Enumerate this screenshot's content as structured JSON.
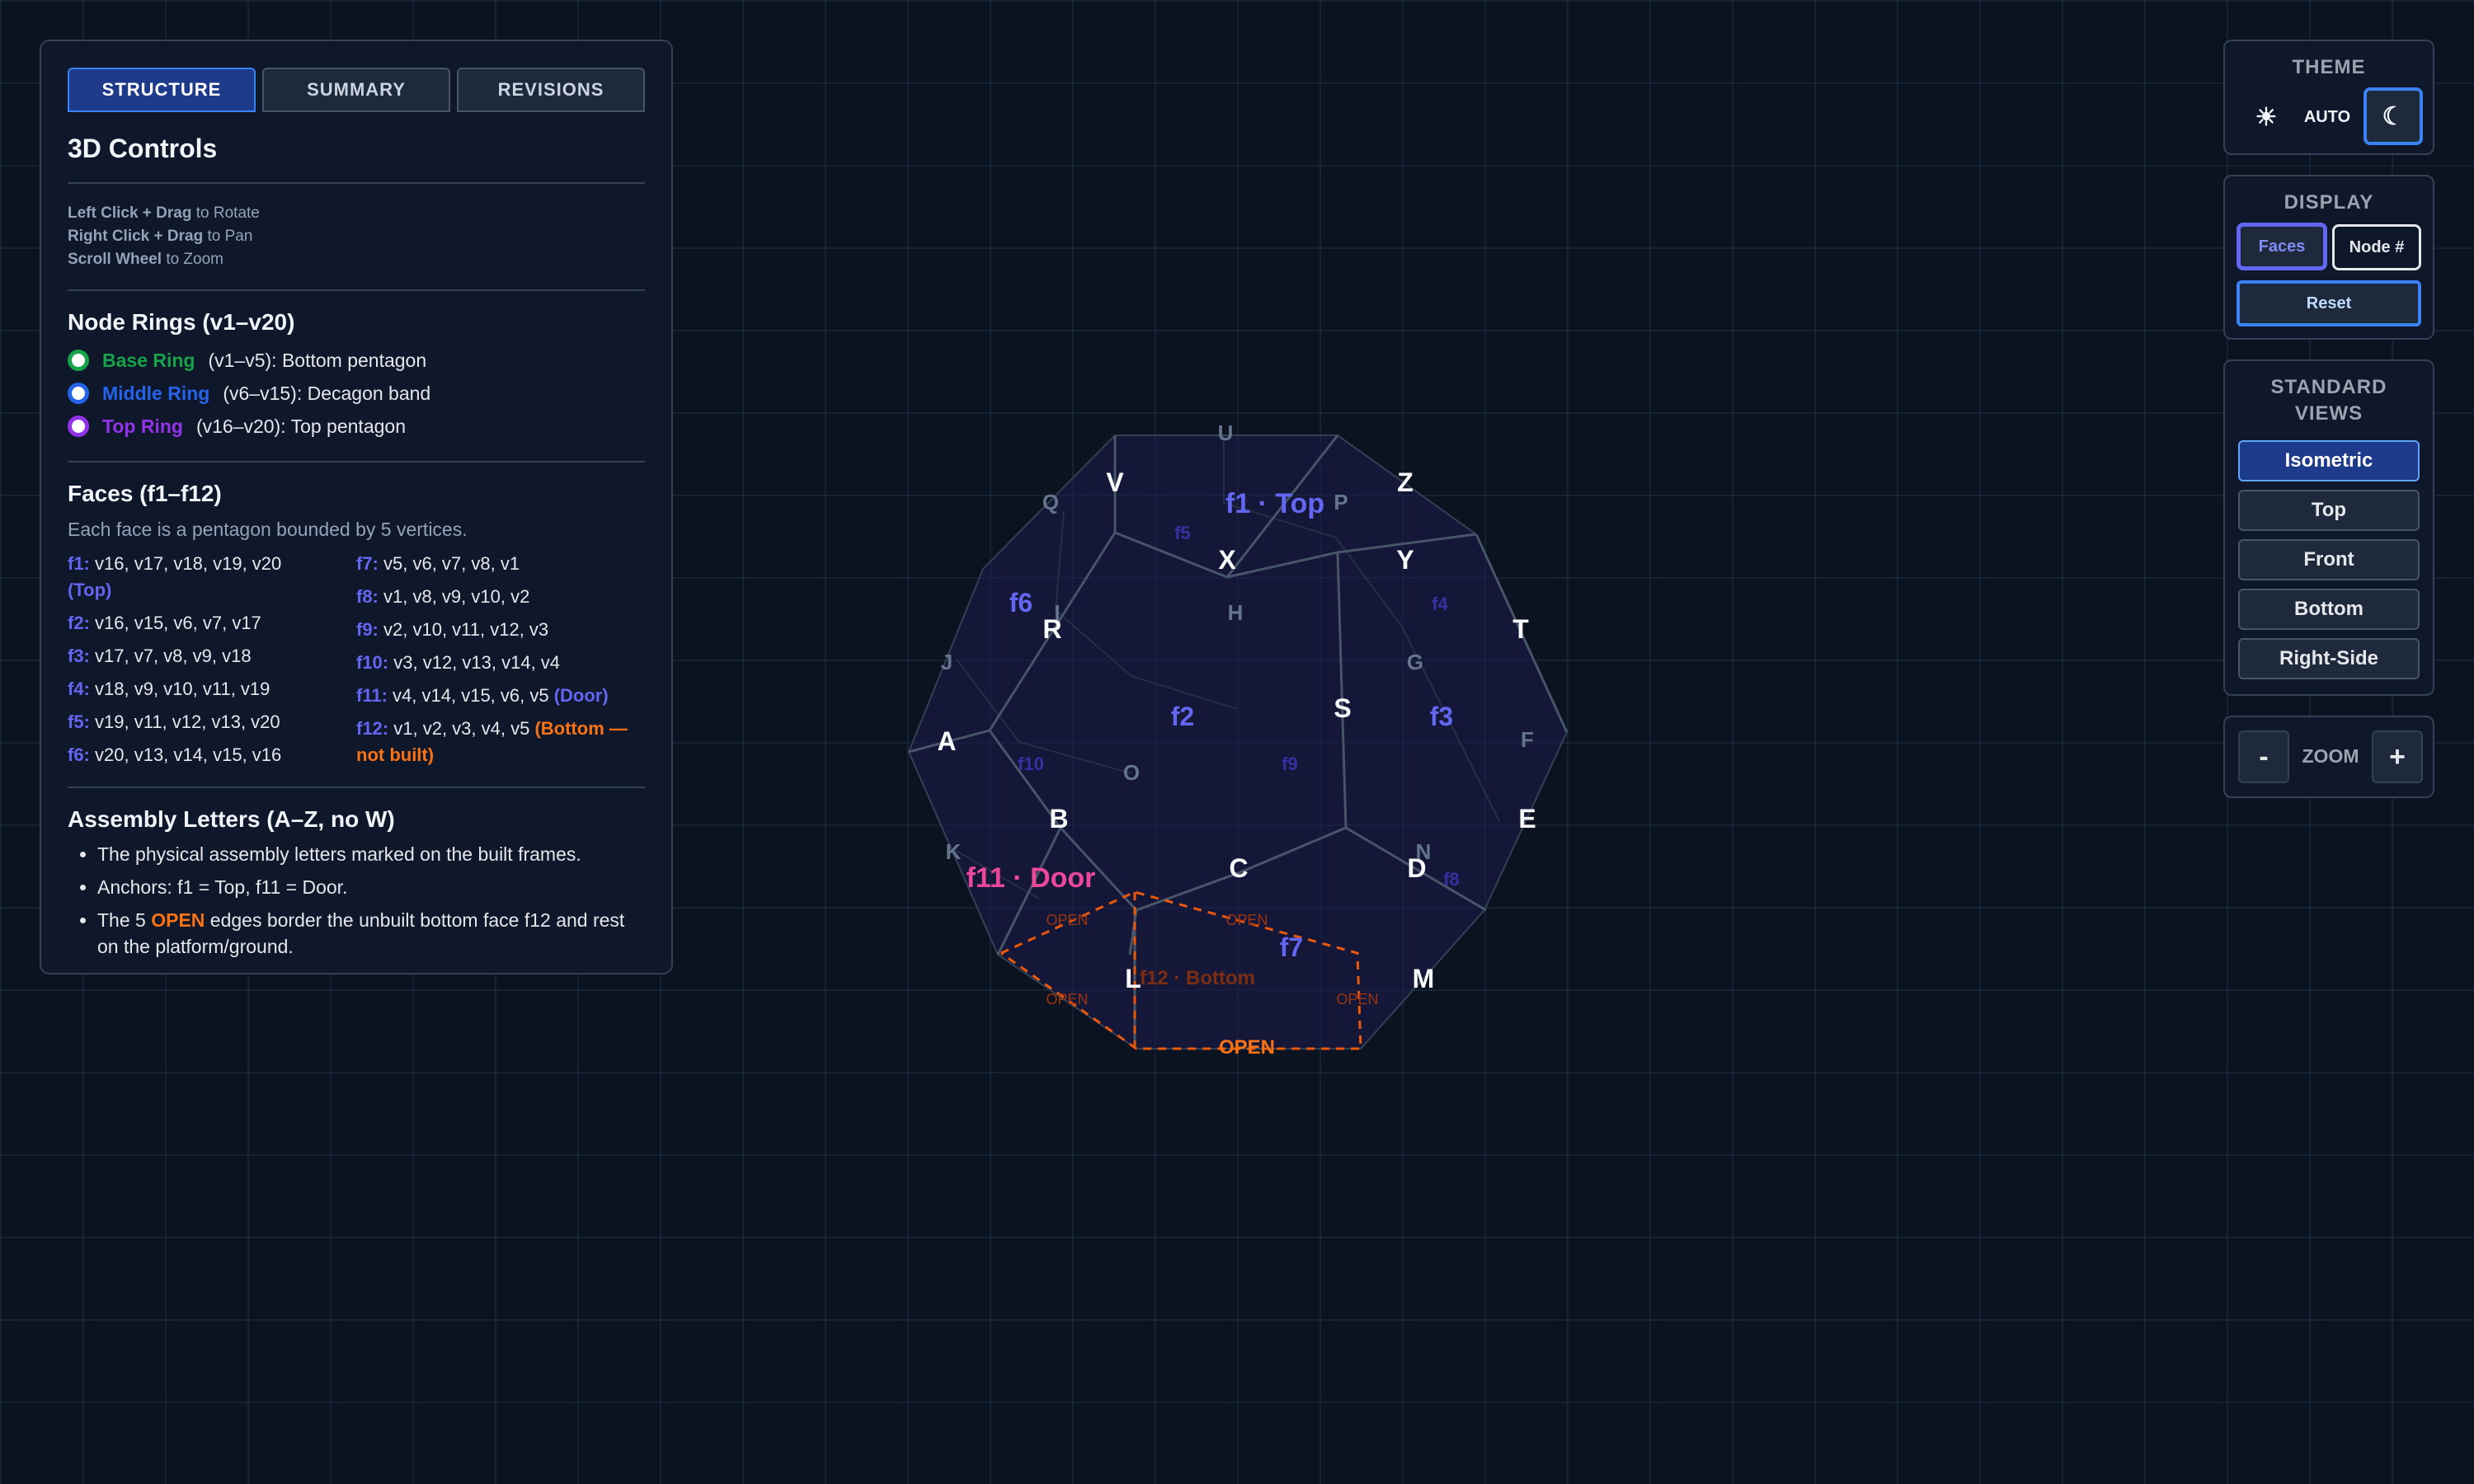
{
  "tabs": [
    {
      "label": "STRUCTURE"
    },
    {
      "label": "SUMMARY"
    },
    {
      "label": "REVISIONS"
    }
  ],
  "controls": {
    "title": "3D Controls",
    "items": [
      {
        "key": "Left Click + Drag",
        "text": "to Rotate"
      },
      {
        "key": "Right Click + Drag",
        "text": "to Pan"
      },
      {
        "key": "Scroll Wheel",
        "text": "to Zoom"
      }
    ]
  },
  "rings": {
    "title": "Node Rings (v1–v20)",
    "items": [
      {
        "name": "Base Ring",
        "range": "(v1–v5): Bottom pentagon",
        "color": "#16a34a"
      },
      {
        "name": "Middle Ring",
        "range": "(v6–v15): Decagon band",
        "color": "#2563eb"
      },
      {
        "name": "Top Ring",
        "range": "(v16–v20): Top pentagon",
        "color": "#9333ea"
      }
    ]
  },
  "faces": {
    "title": "Faces (f1–f12)",
    "description": "Each face is a pentagon bounded by 5 vertices.",
    "col1": [
      {
        "id": "f1:",
        "verts": "v16, v17, v18, v19, v20",
        "note": "(Top)"
      },
      {
        "id": "f2:",
        "verts": "v16, v15, v6, v7, v17",
        "note": ""
      },
      {
        "id": "f3:",
        "verts": "v17, v7, v8, v9, v18",
        "note": ""
      },
      {
        "id": "f4:",
        "verts": "v18, v9, v10, v11, v19",
        "note": ""
      },
      {
        "id": "f5:",
        "verts": "v19, v11, v12, v13, v20",
        "note": ""
      },
      {
        "id": "f6:",
        "verts": "v20, v13, v14, v15, v16",
        "note": ""
      }
    ],
    "col2": [
      {
        "id": "f7:",
        "verts": "v5, v6, v7, v8, v1",
        "note": ""
      },
      {
        "id": "f8:",
        "verts": "v1, v8, v9, v10, v2",
        "note": ""
      },
      {
        "id": "f9:",
        "verts": "v2, v10, v11, v12, v3",
        "note": ""
      },
      {
        "id": "f10:",
        "verts": "v3, v12, v13, v14, v4",
        "note": ""
      },
      {
        "id": "f11:",
        "verts": "v4, v14, v15, v6, v5",
        "note": "(Door)"
      },
      {
        "id": "f12:",
        "verts": "v1, v2, v3, v4, v5",
        "note": "(Bottom — not built)"
      }
    ]
  },
  "assembly": {
    "title": "Assembly Letters (A–Z, no W)",
    "item1": "The physical assembly letters marked on the built frames.",
    "item2": "Anchors: f1 = Top, f11 = Door.",
    "item3_pre": "The 5",
    "item3_open": "OPEN",
    "item3_post": "edges border the unbuilt bottom face f12 and rest on the platform/ground."
  },
  "theme": {
    "title": "THEME",
    "light_icon": "☀",
    "auto_label": "AUTO",
    "dark_icon": "☾",
    "active": "dark"
  },
  "display": {
    "title": "DISPLAY",
    "faces_label": "Faces",
    "node_label": "Node #",
    "reset_label": "Reset"
  },
  "views": {
    "title_line1": "STANDARD",
    "title_line2": "VIEWS",
    "items": [
      {
        "label": "Isometric",
        "active": true
      },
      {
        "label": "Top",
        "active": false
      },
      {
        "label": "Front",
        "active": false
      },
      {
        "label": "Bottom",
        "active": false
      },
      {
        "label": "Right-Side",
        "active": false
      }
    ]
  },
  "zoom": {
    "minus": "-",
    "label": "ZOOM",
    "plus": "+"
  },
  "model": {
    "colors": {
      "face_fill": "#1e1b4b",
      "edge": "#475569",
      "open_edge": "#ea580c",
      "face_label": "#6366f1",
      "door": "#ec4899"
    },
    "letters_front": [
      "V",
      "Z",
      "X",
      "Y",
      "R",
      "T",
      "S",
      "A",
      "B",
      "E",
      "C",
      "D",
      "L",
      "M"
    ],
    "letters_back": [
      "U",
      "Q",
      "P",
      "I",
      "H",
      "J",
      "G",
      "F",
      "O",
      "K",
      "N"
    ],
    "face_labels_main": [
      "f1 · Top",
      "f2",
      "f3",
      "f6",
      "f7"
    ],
    "face_labels_small": [
      "f5",
      "f4",
      "f9",
      "f10",
      "f8"
    ],
    "door_label": "f11 · Door",
    "bottom_label": "f12 · Bottom",
    "open_label": "OPEN",
    "open_small": "OPEN"
  }
}
